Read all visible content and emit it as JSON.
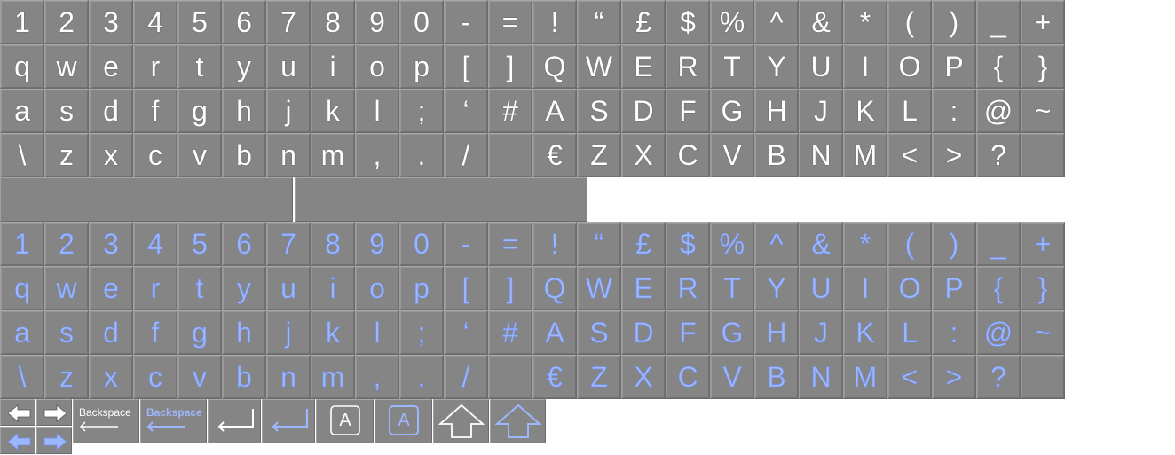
{
  "keyboards": [
    {
      "style": "white",
      "rows": [
        [
          "1",
          "2",
          "3",
          "4",
          "5",
          "6",
          "7",
          "8",
          "9",
          "0",
          "-",
          "=",
          "!",
          "“",
          "£",
          "$",
          "%",
          "^",
          "&",
          "*",
          "(",
          ")",
          "_",
          "+"
        ],
        [
          "q",
          "w",
          "e",
          "r",
          "t",
          "y",
          "u",
          "i",
          "o",
          "p",
          "[",
          "]",
          "Q",
          "W",
          "E",
          "R",
          "T",
          "Y",
          "U",
          "I",
          "O",
          "P",
          "{",
          "}"
        ],
        [
          "a",
          "s",
          "d",
          "f",
          "g",
          "h",
          "j",
          "k",
          "l",
          ";",
          "‘",
          "#",
          "A",
          "S",
          "D",
          "F",
          "G",
          "H",
          "J",
          "K",
          "L",
          ":",
          "@",
          "~"
        ],
        [
          "\\",
          "z",
          "x",
          "c",
          "v",
          "b",
          "n",
          "m",
          ",",
          ".",
          "/",
          "",
          "€",
          "Z",
          "X",
          "C",
          "V",
          "B",
          "N",
          "M",
          "<",
          ">",
          "?",
          ""
        ]
      ]
    },
    {
      "style": "blue",
      "rows": [
        [
          "1",
          "2",
          "3",
          "4",
          "5",
          "6",
          "7",
          "8",
          "9",
          "0",
          "-",
          "=",
          "!",
          "“",
          "£",
          "$",
          "%",
          "^",
          "&",
          "*",
          "(",
          ")",
          "_",
          "+"
        ],
        [
          "q",
          "w",
          "e",
          "r",
          "t",
          "y",
          "u",
          "i",
          "o",
          "p",
          "[",
          "]",
          "Q",
          "W",
          "E",
          "R",
          "T",
          "Y",
          "U",
          "I",
          "O",
          "P",
          "{",
          "}"
        ],
        [
          "a",
          "s",
          "d",
          "f",
          "g",
          "h",
          "j",
          "k",
          "l",
          ";",
          "‘",
          "#",
          "A",
          "S",
          "D",
          "F",
          "G",
          "H",
          "J",
          "K",
          "L",
          ":",
          "@",
          "~"
        ],
        [
          "\\",
          "z",
          "x",
          "c",
          "v",
          "b",
          "n",
          "m",
          ",",
          ".",
          "/",
          "",
          "€",
          "Z",
          "X",
          "C",
          "V",
          "B",
          "N",
          "M",
          "<",
          ">",
          "?",
          ""
        ]
      ]
    }
  ],
  "special_keys": {
    "backspace_label": "Backspace",
    "backspace_label_blue": "Backspace",
    "caps_glyph": "A",
    "caps_glyph_blue": "A"
  },
  "colors": {
    "key_bg": "#858585",
    "white_glyph": "#ffffff",
    "blue_glyph": "#9db7ff"
  }
}
